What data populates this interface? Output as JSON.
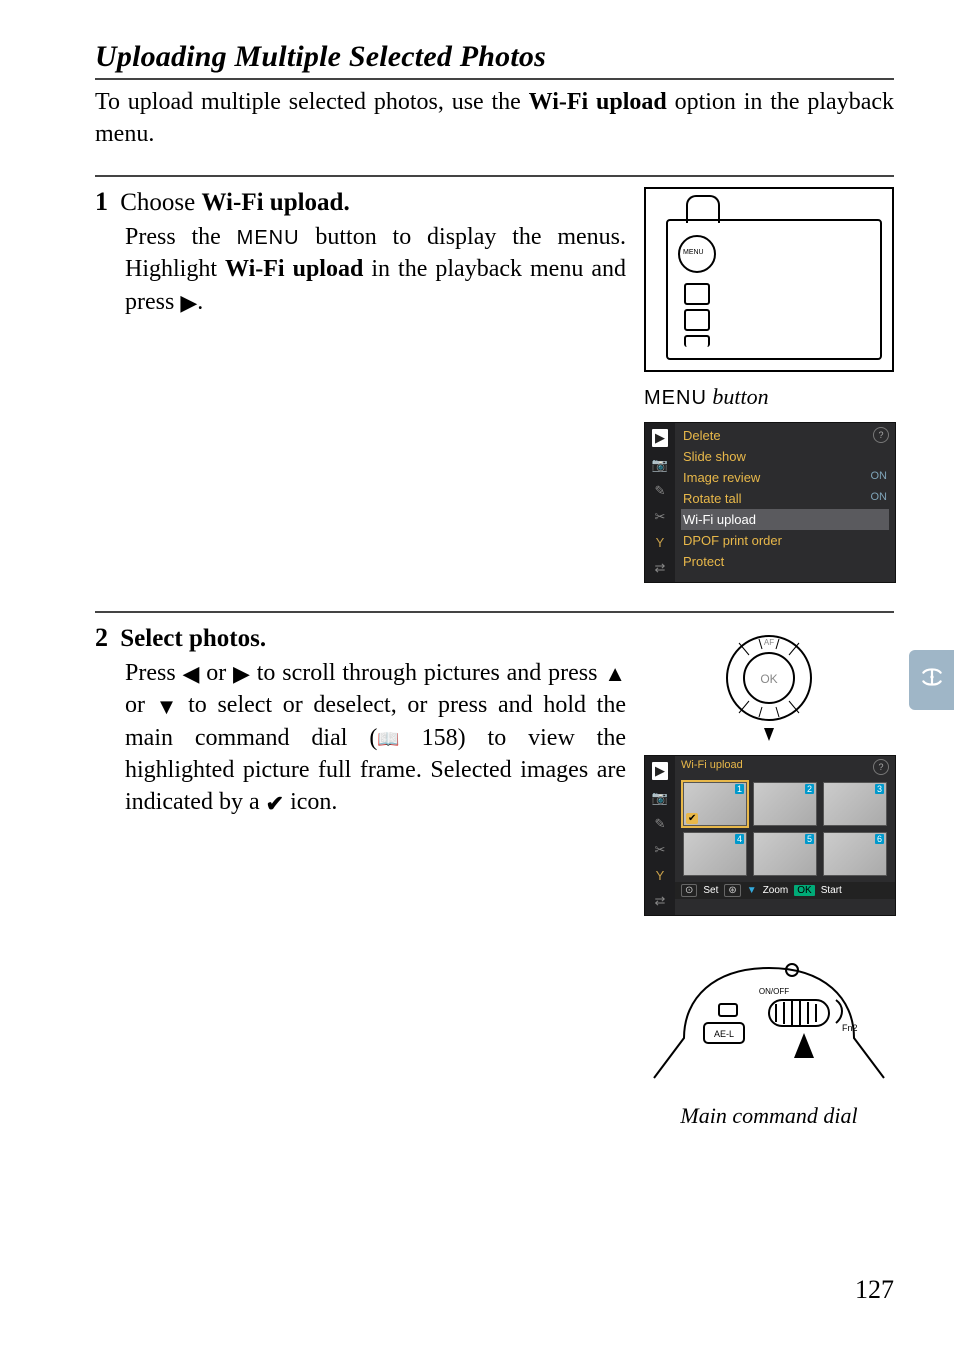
{
  "titles": {
    "section": "Uploading Multiple Selected Photos"
  },
  "intro": {
    "pre": "To upload multiple selected photos, use the ",
    "bold": "Wi-Fi upload",
    "post": " option in the playback menu."
  },
  "steps": {
    "one": {
      "num": "1",
      "title_pre": "Choose ",
      "title_bold": "Wi-Fi upload.",
      "body_a": "Press the ",
      "body_menu": "MENU",
      "body_b": " button to display the menus. Highlight ",
      "body_bold": "Wi-Fi upload",
      "body_c": " in the playback menu and press ",
      "body_glyph": "▶",
      "body_d": "."
    },
    "two": {
      "num": "2",
      "title": "Select photos.",
      "body_a": "Press ",
      "g_left": "◀",
      "body_b": " or ",
      "g_right": "▶",
      "body_c": " to scroll through pictures and press ",
      "g_up": "▲",
      "body_d": " or ",
      "g_down": "▼",
      "body_e": " to select or deselect, or press and hold the main command dial (",
      "book": "📖",
      "page_ref": "158",
      "body_f": ") to view the highlighted picture full frame. Selected images are indicated by a ",
      "mark_glyph": "✔",
      "body_g": " icon."
    }
  },
  "captions": {
    "menu_button_glyph": "MENU",
    "menu_button_text": " button",
    "main_command_dial": "Main command dial"
  },
  "lcd_menu": {
    "items": [
      {
        "label": "Delete",
        "val": ""
      },
      {
        "label": "Slide show",
        "val": ""
      },
      {
        "label": "Image review",
        "val": "ON"
      },
      {
        "label": "Rotate tall",
        "val": "ON"
      },
      {
        "label": "Wi-Fi upload",
        "val": ""
      },
      {
        "label": "DPOF print order",
        "val": ""
      },
      {
        "label": "Protect",
        "val": ""
      }
    ]
  },
  "lcd_upload": {
    "title": "Wi-Fi upload",
    "footer": {
      "k1": "⊙",
      "t1": "Set",
      "k2": "⊛",
      "t2_pre": "▼",
      "t2": " Zoom",
      "ok": "OK",
      "t3": "Start"
    }
  },
  "tab": "((📶))",
  "page_number": "127"
}
